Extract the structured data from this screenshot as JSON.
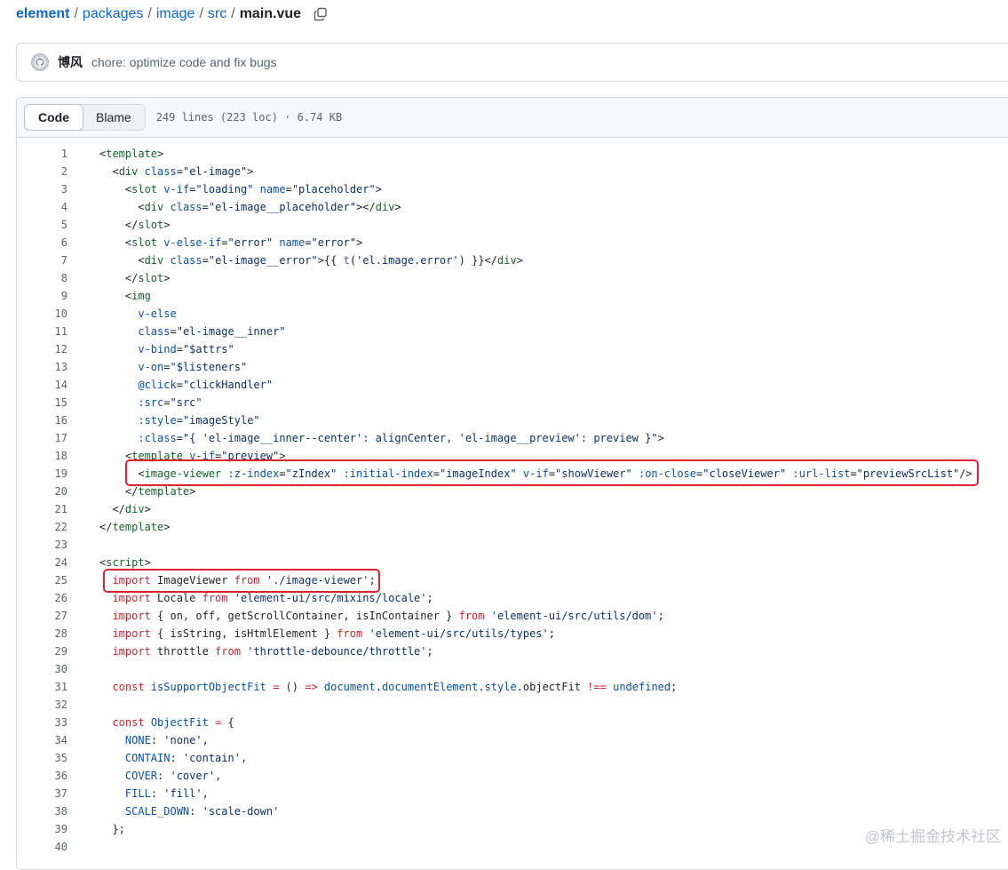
{
  "breadcrumb": {
    "items": [
      "element",
      "packages",
      "image",
      "src"
    ],
    "separator": "/",
    "file": "main.vue"
  },
  "commit": {
    "author": "博风",
    "message": "chore: optimize code and fix bugs"
  },
  "file_header": {
    "tabs": [
      {
        "label": "Code",
        "active": true
      },
      {
        "label": "Blame",
        "active": false
      }
    ],
    "info": "249 lines (223 loc) · 6.74 KB"
  },
  "code_lines": [
    {
      "n": "1",
      "tokens": [
        [
          "",
          "<"
        ],
        [
          "green",
          "template"
        ],
        [
          "",
          ">"
        ]
      ]
    },
    {
      "n": "2",
      "tokens": [
        [
          "",
          "  <"
        ],
        [
          "green",
          "div"
        ],
        [
          "",
          " "
        ],
        [
          "blue",
          "class"
        ],
        [
          "",
          "="
        ],
        [
          "navy",
          "\"el-image\""
        ],
        [
          "",
          ">"
        ]
      ]
    },
    {
      "n": "3",
      "tokens": [
        [
          "",
          "    <"
        ],
        [
          "green",
          "slot"
        ],
        [
          "",
          " "
        ],
        [
          "blue",
          "v-if"
        ],
        [
          "",
          "="
        ],
        [
          "navy",
          "\"loading\""
        ],
        [
          "",
          " "
        ],
        [
          "blue",
          "name"
        ],
        [
          "",
          "="
        ],
        [
          "navy",
          "\"placeholder\""
        ],
        [
          "",
          ">"
        ]
      ]
    },
    {
      "n": "4",
      "tokens": [
        [
          "",
          "      <"
        ],
        [
          "green",
          "div"
        ],
        [
          "",
          " "
        ],
        [
          "blue",
          "class"
        ],
        [
          "",
          "="
        ],
        [
          "navy",
          "\"el-image__placeholder\""
        ],
        [
          "",
          "></"
        ],
        [
          "green",
          "div"
        ],
        [
          "",
          ">"
        ]
      ]
    },
    {
      "n": "5",
      "tokens": [
        [
          "",
          "    </"
        ],
        [
          "green",
          "slot"
        ],
        [
          "",
          ">"
        ]
      ]
    },
    {
      "n": "6",
      "tokens": [
        [
          "",
          "    <"
        ],
        [
          "green",
          "slot"
        ],
        [
          "",
          " "
        ],
        [
          "blue",
          "v-else-if"
        ],
        [
          "",
          "="
        ],
        [
          "navy",
          "\"error\""
        ],
        [
          "",
          " "
        ],
        [
          "blue",
          "name"
        ],
        [
          "",
          "="
        ],
        [
          "navy",
          "\"error\""
        ],
        [
          "",
          ">"
        ]
      ]
    },
    {
      "n": "7",
      "tokens": [
        [
          "",
          "      <"
        ],
        [
          "green",
          "div"
        ],
        [
          "",
          " "
        ],
        [
          "blue",
          "class"
        ],
        [
          "",
          "="
        ],
        [
          "navy",
          "\"el-image__error\""
        ],
        [
          "",
          ">{{ "
        ],
        [
          "purple",
          "t"
        ],
        [
          "",
          "("
        ],
        [
          "navy",
          "'el.image.error'"
        ],
        [
          "",
          ") }}</"
        ],
        [
          "green",
          "div"
        ],
        [
          "",
          ">"
        ]
      ]
    },
    {
      "n": "8",
      "tokens": [
        [
          "",
          "    </"
        ],
        [
          "green",
          "slot"
        ],
        [
          "",
          ">"
        ]
      ]
    },
    {
      "n": "9",
      "tokens": [
        [
          "",
          "    <"
        ],
        [
          "green",
          "img"
        ]
      ]
    },
    {
      "n": "10",
      "tokens": [
        [
          "",
          "      "
        ],
        [
          "blue",
          "v-else"
        ]
      ]
    },
    {
      "n": "11",
      "tokens": [
        [
          "",
          "      "
        ],
        [
          "blue",
          "class"
        ],
        [
          "",
          "="
        ],
        [
          "navy",
          "\"el-image__inner\""
        ]
      ]
    },
    {
      "n": "12",
      "tokens": [
        [
          "",
          "      "
        ],
        [
          "blue",
          "v-bind"
        ],
        [
          "",
          "="
        ],
        [
          "navy",
          "\"$attrs\""
        ]
      ]
    },
    {
      "n": "13",
      "tokens": [
        [
          "",
          "      "
        ],
        [
          "blue",
          "v-on"
        ],
        [
          "",
          "="
        ],
        [
          "navy",
          "\"$listeners\""
        ]
      ]
    },
    {
      "n": "14",
      "tokens": [
        [
          "",
          "      "
        ],
        [
          "blue",
          "@click"
        ],
        [
          "",
          "="
        ],
        [
          "navy",
          "\"clickHandler\""
        ]
      ]
    },
    {
      "n": "15",
      "tokens": [
        [
          "",
          "      "
        ],
        [
          "blue",
          ":src"
        ],
        [
          "",
          "="
        ],
        [
          "navy",
          "\"src\""
        ]
      ]
    },
    {
      "n": "16",
      "tokens": [
        [
          "",
          "      "
        ],
        [
          "blue",
          ":style"
        ],
        [
          "",
          "="
        ],
        [
          "navy",
          "\"imageStyle\""
        ]
      ]
    },
    {
      "n": "17",
      "tokens": [
        [
          "",
          "      "
        ],
        [
          "blue",
          ":class"
        ],
        [
          "",
          "="
        ],
        [
          "navy",
          "\"{ 'el-image__inner--center': alignCenter, 'el-image__preview': preview }\""
        ],
        [
          "",
          ">"
        ]
      ]
    },
    {
      "n": "18",
      "tokens": [
        [
          "",
          "    <"
        ],
        [
          "green",
          "template"
        ],
        [
          "",
          " "
        ],
        [
          "blue",
          "v-if"
        ],
        [
          "",
          "="
        ],
        [
          "navy",
          "\"preview\""
        ],
        [
          "",
          ">"
        ]
      ]
    },
    {
      "n": "19",
      "tokens": [
        [
          "",
          "      <"
        ],
        [
          "green",
          "image-viewer"
        ],
        [
          "",
          " "
        ],
        [
          "blue",
          ":z-index"
        ],
        [
          "",
          "="
        ],
        [
          "navy",
          "\"zIndex\""
        ],
        [
          "",
          " "
        ],
        [
          "blue",
          ":initial-index"
        ],
        [
          "",
          "="
        ],
        [
          "navy",
          "\"imageIndex\""
        ],
        [
          "",
          " "
        ],
        [
          "blue",
          "v-if"
        ],
        [
          "",
          "="
        ],
        [
          "navy",
          "\"showViewer\""
        ],
        [
          "",
          " "
        ],
        [
          "blue",
          ":on-close"
        ],
        [
          "",
          "="
        ],
        [
          "navy",
          "\"closeViewer\""
        ],
        [
          "",
          " "
        ],
        [
          "blue",
          ":url-list"
        ],
        [
          "",
          "="
        ],
        [
          "navy",
          "\"previewSrcList\""
        ],
        [
          "",
          "/>"
        ]
      ]
    },
    {
      "n": "20",
      "tokens": [
        [
          "",
          "    </"
        ],
        [
          "green",
          "template"
        ],
        [
          "",
          ">"
        ]
      ]
    },
    {
      "n": "21",
      "tokens": [
        [
          "",
          "  </"
        ],
        [
          "green",
          "div"
        ],
        [
          "",
          ">"
        ]
      ]
    },
    {
      "n": "22",
      "tokens": [
        [
          "",
          "</"
        ],
        [
          "green",
          "template"
        ],
        [
          "",
          ">"
        ]
      ]
    },
    {
      "n": "23",
      "tokens": []
    },
    {
      "n": "24",
      "tokens": [
        [
          "",
          "<"
        ],
        [
          "green",
          "script"
        ],
        [
          "",
          ">"
        ]
      ]
    },
    {
      "n": "25",
      "tokens": [
        [
          "",
          "  "
        ],
        [
          "red",
          "import"
        ],
        [
          "",
          " ImageViewer "
        ],
        [
          "red",
          "from"
        ],
        [
          "",
          " "
        ],
        [
          "navy",
          "'./image-viewer'"
        ],
        [
          "",
          ";"
        ]
      ]
    },
    {
      "n": "26",
      "tokens": [
        [
          "",
          "  "
        ],
        [
          "red",
          "import"
        ],
        [
          "",
          " Locale "
        ],
        [
          "red",
          "from"
        ],
        [
          "",
          " "
        ],
        [
          "navy",
          "'element-ui/src/mixins/locale'"
        ],
        [
          "",
          ";"
        ]
      ]
    },
    {
      "n": "27",
      "tokens": [
        [
          "",
          "  "
        ],
        [
          "red",
          "import"
        ],
        [
          "",
          " { on, off, getScrollContainer, isInContainer } "
        ],
        [
          "red",
          "from"
        ],
        [
          "",
          " "
        ],
        [
          "navy",
          "'element-ui/src/utils/dom'"
        ],
        [
          "",
          ";"
        ]
      ]
    },
    {
      "n": "28",
      "tokens": [
        [
          "",
          "  "
        ],
        [
          "red",
          "import"
        ],
        [
          "",
          " { isString, isHtmlElement } "
        ],
        [
          "red",
          "from"
        ],
        [
          "",
          " "
        ],
        [
          "navy",
          "'element-ui/src/utils/types'"
        ],
        [
          "",
          ";"
        ]
      ]
    },
    {
      "n": "29",
      "tokens": [
        [
          "",
          "  "
        ],
        [
          "red",
          "import"
        ],
        [
          "",
          " throttle "
        ],
        [
          "red",
          "from"
        ],
        [
          "",
          " "
        ],
        [
          "navy",
          "'throttle-debounce/throttle'"
        ],
        [
          "",
          ";"
        ]
      ]
    },
    {
      "n": "30",
      "tokens": []
    },
    {
      "n": "31",
      "tokens": [
        [
          "",
          "  "
        ],
        [
          "red",
          "const"
        ],
        [
          "",
          " "
        ],
        [
          "blue",
          "isSupportObjectFit"
        ],
        [
          "",
          " "
        ],
        [
          "red",
          "="
        ],
        [
          "",
          " () "
        ],
        [
          "red",
          "=>"
        ],
        [
          "",
          " "
        ],
        [
          "blue",
          "document"
        ],
        [
          "",
          "."
        ],
        [
          "blue",
          "documentElement"
        ],
        [
          "",
          "."
        ],
        [
          "blue",
          "style"
        ],
        [
          "",
          ".objectFit "
        ],
        [
          "red",
          "!=="
        ],
        [
          "",
          " "
        ],
        [
          "blue",
          "undefined"
        ],
        [
          "",
          ";"
        ]
      ]
    },
    {
      "n": "32",
      "tokens": []
    },
    {
      "n": "33",
      "tokens": [
        [
          "",
          "  "
        ],
        [
          "red",
          "const"
        ],
        [
          "",
          " "
        ],
        [
          "blue",
          "ObjectFit"
        ],
        [
          "",
          " "
        ],
        [
          "red",
          "="
        ],
        [
          "",
          " {"
        ]
      ]
    },
    {
      "n": "34",
      "tokens": [
        [
          "",
          "    "
        ],
        [
          "blue",
          "NONE"
        ],
        [
          "",
          ": "
        ],
        [
          "navy",
          "'none'"
        ],
        [
          "",
          ","
        ]
      ]
    },
    {
      "n": "35",
      "tokens": [
        [
          "",
          "    "
        ],
        [
          "blue",
          "CONTAIN"
        ],
        [
          "",
          ": "
        ],
        [
          "navy",
          "'contain'"
        ],
        [
          "",
          ","
        ]
      ]
    },
    {
      "n": "36",
      "tokens": [
        [
          "",
          "    "
        ],
        [
          "blue",
          "COVER"
        ],
        [
          "",
          ": "
        ],
        [
          "navy",
          "'cover'"
        ],
        [
          "",
          ","
        ]
      ]
    },
    {
      "n": "37",
      "tokens": [
        [
          "",
          "    "
        ],
        [
          "blue",
          "FILL"
        ],
        [
          "",
          ": "
        ],
        [
          "navy",
          "'fill'"
        ],
        [
          "",
          ","
        ]
      ]
    },
    {
      "n": "38",
      "tokens": [
        [
          "",
          "    "
        ],
        [
          "blue",
          "SCALE_DOWN"
        ],
        [
          "",
          ": "
        ],
        [
          "navy",
          "'scale-down'"
        ]
      ]
    },
    {
      "n": "39",
      "tokens": [
        [
          "",
          "  };"
        ]
      ]
    },
    {
      "n": "40",
      "tokens": []
    }
  ],
  "watermark": "@稀土掘金技术社区",
  "colors": {
    "link": "#0969da",
    "tag": "#116329",
    "attr": "#0550ae",
    "string": "#0a3069",
    "keyword": "#cf222e",
    "function": "#6f42c1",
    "highlight_box": "#e0202a"
  },
  "icons": [
    "copy-icon",
    "github-avatar-icon"
  ]
}
